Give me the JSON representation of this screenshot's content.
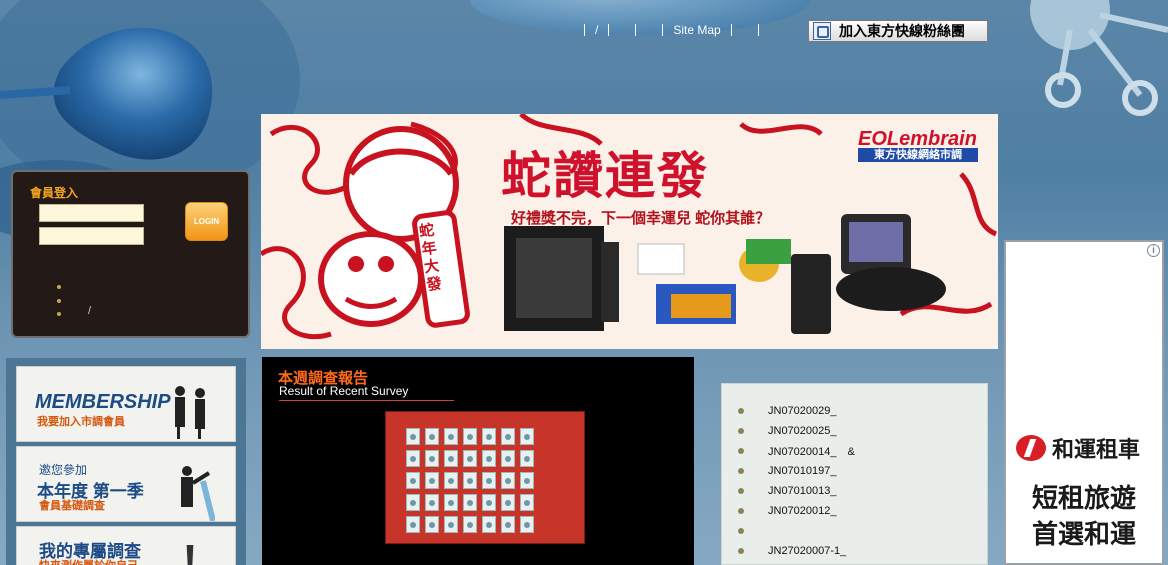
{
  "topnav": {
    "slash": "/",
    "sitemap": "Site Map",
    "fans_button": "加入東方快線粉絲團"
  },
  "login": {
    "title": "會員登入",
    "button": "LOGIN",
    "slash": "/"
  },
  "banner": {
    "title": "蛇讚連發",
    "subtitle": "好禮獎不完，下一個幸運兒 蛇你其誰？",
    "logo": "EOLembrain",
    "logo_sub": "東方快線網絡市調",
    "badge": "蛇年大發"
  },
  "side_menu": {
    "membership_title": "MEMBERSHIP",
    "membership_sub": "我要加入市調會員",
    "season_invite": "邀您參加",
    "season_title": "本年度 第一季",
    "season_sub": "會員基礎調查",
    "exclusive_title": "我的專屬調查",
    "exclusive_sub": "快來測作屬於你自己"
  },
  "survey": {
    "title": "本週調查報告",
    "subtitle": "Result of Recent Survey"
  },
  "report_list": [
    {
      "code": "JN07020029_"
    },
    {
      "code": "JN07020025_"
    },
    {
      "code": "JN07020014_　&"
    },
    {
      "code": "JN07010197_"
    },
    {
      "code": "JN07010013_"
    },
    {
      "code": "JN07020012_"
    },
    {
      "code": ""
    },
    {
      "code": "JN27020007-1_"
    }
  ],
  "ad": {
    "info_icon": "i",
    "brand": "和運租車",
    "line1": "短租旅遊",
    "line2": "首選和運"
  }
}
